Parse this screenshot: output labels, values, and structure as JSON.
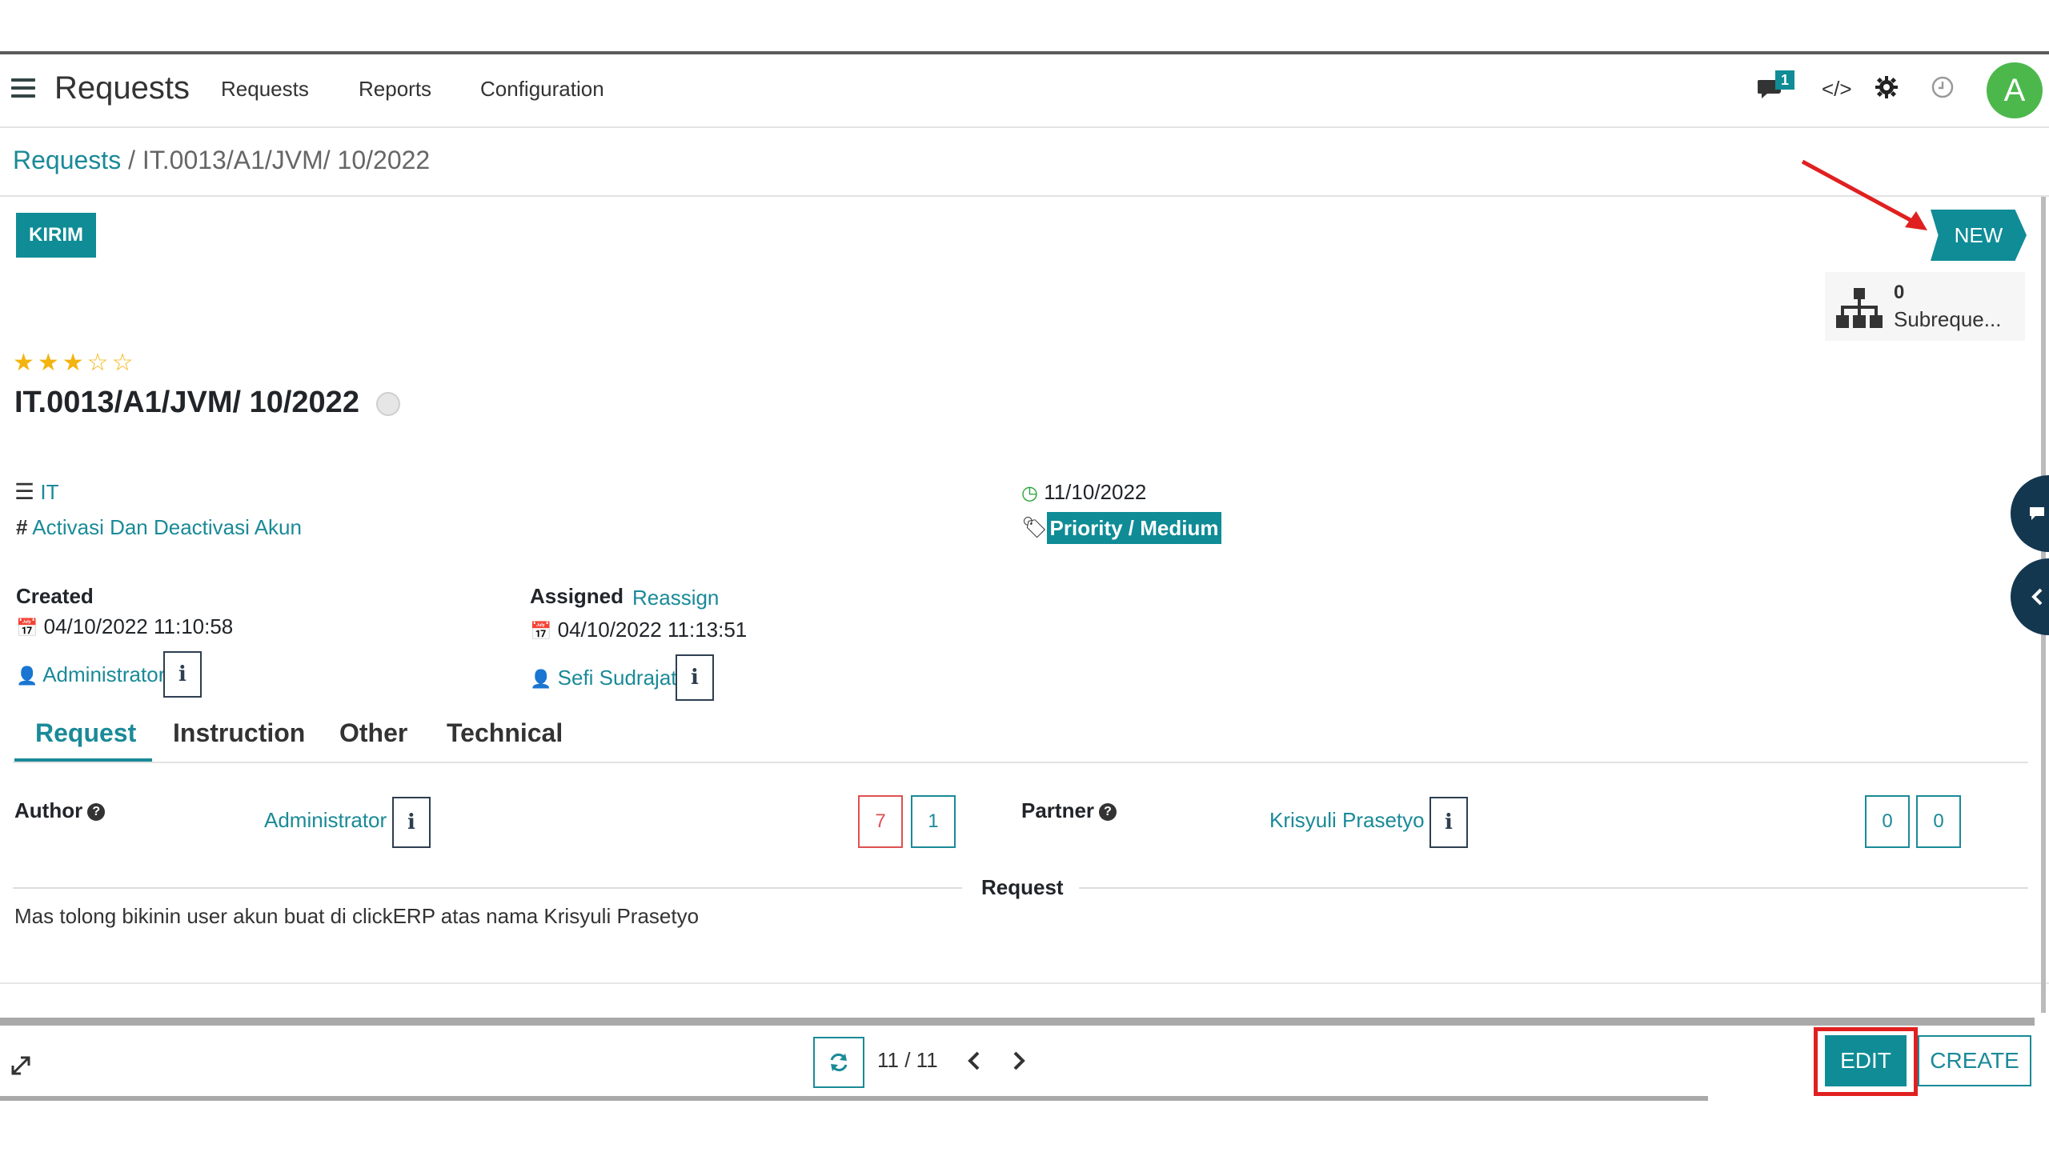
{
  "navbar": {
    "app_title": "Requests",
    "menu": [
      "Requests",
      "Reports",
      "Configuration"
    ],
    "chat_badge": "1",
    "avatar_letter": "A"
  },
  "breadcrumb": {
    "root": "Requests",
    "separator": "/",
    "current": "IT.0013/A1/JVM/ 10/2022"
  },
  "actions": {
    "kirim": "KIRIM"
  },
  "stage": {
    "current": "NEW"
  },
  "smart_button": {
    "count": "0",
    "label": "Subreque..."
  },
  "record": {
    "stars": 3,
    "star_display": "★★★☆☆",
    "title": "IT.0013/A1/JVM/ 10/2022",
    "category": "IT",
    "request_type": "Activasi Dan Deactivasi Akun",
    "deadline": "11/10/2022",
    "priority_tag": "Priority / Medium"
  },
  "created": {
    "label": "Created",
    "datetime": "04/10/2022 11:10:58",
    "user": "Administrator"
  },
  "assigned": {
    "label": "Assigned",
    "reassign": "Reassign",
    "datetime": "04/10/2022 11:13:51",
    "user": "Sefi Sudrajat"
  },
  "tabs": [
    "Request",
    "Instruction",
    "Other",
    "Technical"
  ],
  "request_tab": {
    "author_label": "Author",
    "author": "Administrator",
    "author_counts": [
      "7",
      "1"
    ],
    "partner_label": "Partner",
    "partner": "Krisyuli Prasetyo",
    "partner_counts": [
      "0",
      "0"
    ],
    "section_title": "Request",
    "request_text": "Mas tolong bikinin user akun buat di clickERP atas nama Krisyuli Prasetyo"
  },
  "pager": {
    "value": "11 / 11"
  },
  "buttons": {
    "edit": "EDIT",
    "create": "CREATE"
  },
  "colors": {
    "accent": "#0f8c96",
    "link": "#1a8a98",
    "star": "#f3b410",
    "highlight": "#e02020"
  }
}
